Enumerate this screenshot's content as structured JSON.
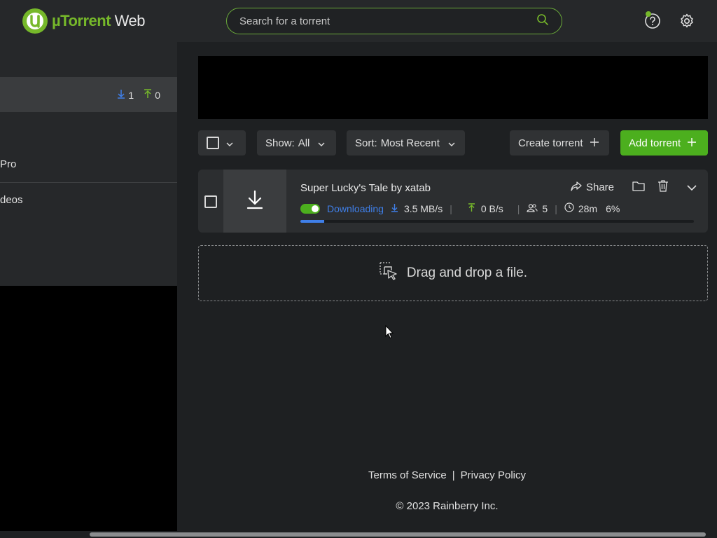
{
  "header": {
    "logo_brand": "µTorrent",
    "logo_web": "Web",
    "search_placeholder": "Search for a torrent"
  },
  "sidebar": {
    "active_down_count": "1",
    "active_up_count": "0",
    "items": [
      "Pro",
      "deos"
    ]
  },
  "toolbar": {
    "show_label": "Show:",
    "show_value": "All",
    "sort_label": "Sort:",
    "sort_value": "Most Recent",
    "create_label": "Create torrent",
    "add_label": "Add torrent"
  },
  "torrent": {
    "name": "Super Lucky's Tale by xatab",
    "share_label": "Share",
    "status": "Downloading",
    "down_speed": "3.5 MB/s",
    "up_speed": "0 B/s",
    "peers": "5",
    "eta": "28m",
    "percent": "6%",
    "progress": 0.06
  },
  "dropzone": {
    "label": "Drag and drop a file."
  },
  "footer": {
    "terms": "Terms of Service",
    "privacy": "Privacy Policy",
    "copyright": "© 2023 Rainberry Inc."
  },
  "colors": {
    "accent_green": "#4caf1e",
    "logo_green": "#76b82a",
    "status_blue": "#3f7fe8"
  }
}
